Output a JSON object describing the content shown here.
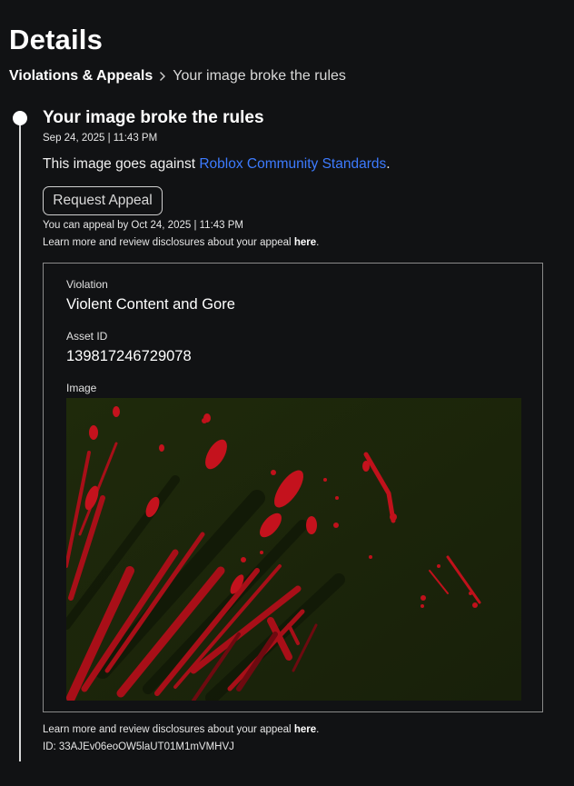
{
  "page": {
    "title": "Details"
  },
  "breadcrumb": {
    "parent": "Violations & Appeals",
    "separator_icon": "chevron-right-icon",
    "current": "Your image broke the rules"
  },
  "event": {
    "title": "Your image broke the rules",
    "timestamp": "Sep 24, 2025 | 11:43 PM",
    "description_prefix": "This image goes against ",
    "description_link": "Roblox Community Standards",
    "description_suffix": ".",
    "appeal_button": "Request Appeal",
    "appeal_deadline": "You can appeal by Oct 24, 2025 | 11:43 PM",
    "disclosure_prefix": "Learn more and review disclosures about your appeal ",
    "disclosure_link": "here",
    "disclosure_suffix": "."
  },
  "details": {
    "violation_label": "Violation",
    "violation_value": "Violent Content and Gore",
    "asset_label": "Asset ID",
    "asset_value": "139817246729078",
    "image_label": "Image"
  },
  "footer": {
    "disclosure_prefix": "Learn more and review disclosures about your appeal ",
    "disclosure_link": "here",
    "disclosure_suffix": ".",
    "id_text": "ID: 33AJEv06eoOW5laUT01M1mVMHVJ"
  },
  "colors": {
    "background": "#111214",
    "link": "#3d7bff",
    "image_background": "#1c2309",
    "blood_red": "#b5101a"
  }
}
